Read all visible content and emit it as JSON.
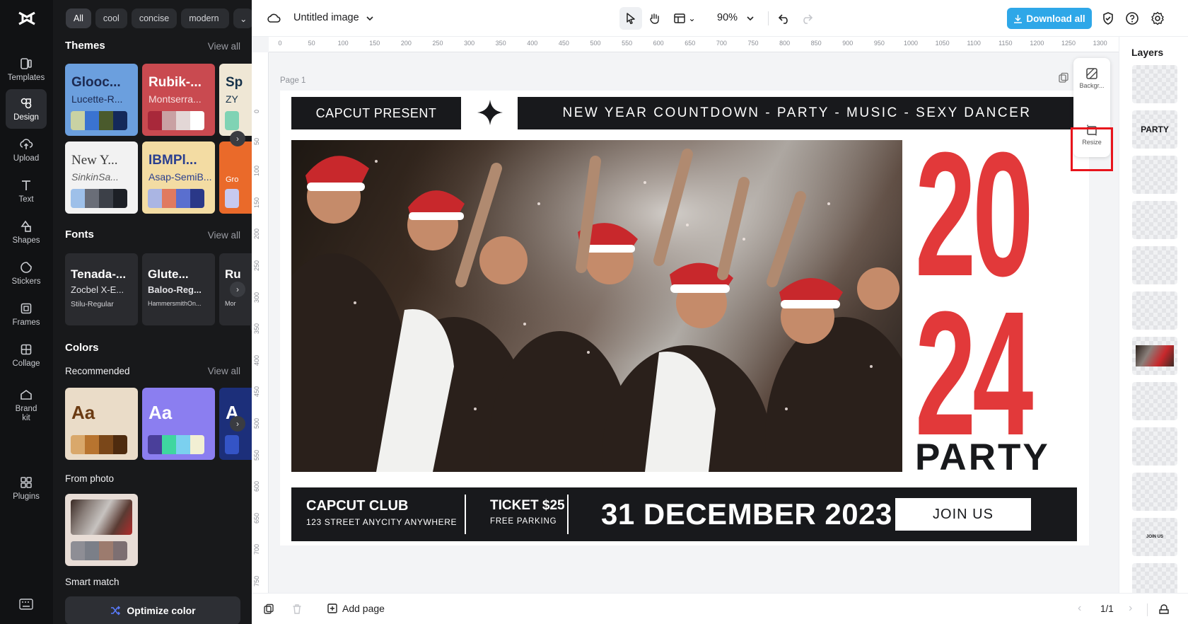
{
  "app": {
    "logo": "capcut-logo"
  },
  "rail": {
    "items": [
      {
        "label": "Templates",
        "icon": "templates-icon"
      },
      {
        "label": "Design",
        "icon": "design-icon",
        "active": true
      },
      {
        "label": "Upload",
        "icon": "upload-icon"
      },
      {
        "label": "Text",
        "icon": "text-icon"
      },
      {
        "label": "Shapes",
        "icon": "shapes-icon"
      },
      {
        "label": "Stickers",
        "icon": "stickers-icon"
      },
      {
        "label": "Frames",
        "icon": "frames-icon"
      },
      {
        "label": "Collage",
        "icon": "collage-icon"
      },
      {
        "label": "Brand kit",
        "icon": "brand-kit-icon"
      },
      {
        "label": "Plugins",
        "icon": "plugins-icon"
      }
    ]
  },
  "panel": {
    "chips": [
      "All",
      "cool",
      "concise",
      "modern"
    ],
    "themes": {
      "title": "Themes",
      "view_all": "View all",
      "cards": [
        {
          "t1": "Glooc...",
          "t2": "Lucette-R...",
          "bg": "#6b9fde",
          "c1": "#1c2a52",
          "c2": "#1c2a52",
          "swatches": [
            "#c9d2a3",
            "#3a73d1",
            "#4a5a2c",
            "#14295a"
          ]
        },
        {
          "t1": "Rubik-...",
          "t2": "Montserra...",
          "bg": "#c94a50",
          "c1": "#ffffff",
          "c2": "#f7dede",
          "swatches": [
            "#a8283a",
            "#c9a1a3",
            "#e3d7d6",
            "#ffffff"
          ]
        },
        {
          "t1": "Sp",
          "t2": "ZY",
          "bg": "#efe7d5",
          "c1": "#16324a",
          "c2": "#16324a",
          "swatches": [
            "#7fd3b4"
          ]
        },
        {
          "t1": "New Y...",
          "t2": "SinkinSa...",
          "bg": "#f2f2f2",
          "c1": "#3a3a3a",
          "c2": "#606060",
          "swatches": [
            "#9ec0e9",
            "#6a6e78",
            "#3c4048",
            "#1d2026"
          ]
        },
        {
          "t1": "IBMPl...",
          "t2": "Asap-SemiB...",
          "bg": "#f3dca3",
          "c1": "#2a3f8f",
          "c2": "#2a3f8f",
          "swatches": [
            "#aab5e3",
            "#e07a5f",
            "#5a6fcf",
            "#2a3888"
          ]
        },
        {
          "t1": "",
          "t2": "Gro",
          "bg": "#ea6a2a",
          "c1": "#ffffff",
          "c2": "#ffffff",
          "swatches": [
            "#c7c9ef"
          ]
        }
      ]
    },
    "fonts": {
      "title": "Fonts",
      "view_all": "View all",
      "cards": [
        {
          "f1": "Tenada-...",
          "f2": "Zocbel X-E...",
          "f3": "Stilu-Regular"
        },
        {
          "f1": "Glute...",
          "f2": "Baloo-Reg...",
          "f3": "HammersmithOn..."
        },
        {
          "f1": "Ru",
          "f2": "",
          "f3": "Mor"
        }
      ]
    },
    "colors": {
      "title": "Colors",
      "recommended": "Recommended",
      "view_all": "View all",
      "cards": [
        {
          "text": "Aa",
          "bg": "#eadcc8",
          "fg": "#6a3a12",
          "swatches": [
            "#d9a86b",
            "#b8742f",
            "#7a4719",
            "#4e2b0e"
          ]
        },
        {
          "text": "Aa",
          "bg": "#8b7ef0",
          "fg": "#ffffff",
          "swatches": [
            "#4a3f9a",
            "#3fd6a0",
            "#7bd0ef",
            "#f2efd3"
          ]
        },
        {
          "text": "A",
          "bg": "#1c2f7a",
          "fg": "#ffffff",
          "swatches": [
            "#3454c6"
          ]
        }
      ],
      "from_photo": "From photo",
      "photo_swatches": [
        "#8e8e95",
        "#7b7f88",
        "#9c7b6e",
        "#7d6f72"
      ],
      "smart_match": "Smart match"
    },
    "optimize_label": "Optimize color"
  },
  "topbar": {
    "title": "Untitled image",
    "zoom": "90%",
    "download_label": "Download all"
  },
  "ruler": {
    "top": [
      "0",
      "50",
      "100",
      "150",
      "200",
      "250",
      "300",
      "350",
      "400",
      "450",
      "500",
      "550",
      "600",
      "650",
      "700",
      "750",
      "800",
      "850",
      "900",
      "950",
      "1000",
      "1050",
      "1100",
      "1150",
      "1200",
      "1250",
      "1300"
    ],
    "left": [
      "0",
      "50",
      "100",
      "150",
      "200",
      "250",
      "300",
      "350",
      "400",
      "450",
      "500",
      "550",
      "600",
      "650",
      "700",
      "750"
    ]
  },
  "canvas": {
    "page_label": "Page 1",
    "design": {
      "presenter": "CAPCUT PRESENT",
      "headline": "NEW YEAR COUNTDOWN - PARTY - MUSIC - SEXY DANCER",
      "year_top": "20",
      "year_bottom": "24",
      "party": "PARTY",
      "club": "CAPCUT CLUB",
      "address": "123 STREET ANYCITY ANYWHERE",
      "ticket": "TICKET $25",
      "parking": "FREE PARKING",
      "date": "31 DECEMBER 2023",
      "join": "JOIN US",
      "accent": "#e2393a",
      "dark": "#18191c"
    },
    "tools": {
      "background": "Backgr...",
      "resize": "Resize"
    }
  },
  "layers": {
    "title": "Layers",
    "items": [
      "",
      "PARTY",
      "",
      "",
      "",
      "",
      "photo",
      "",
      "",
      "",
      "JOIN US",
      ""
    ]
  },
  "bottombar": {
    "add_page": "Add page",
    "page_count": "1/1"
  }
}
